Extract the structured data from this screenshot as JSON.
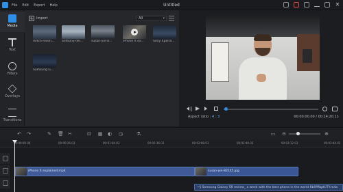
{
  "window": {
    "title": "Untitled",
    "menu": [
      "File",
      "Edit",
      "Export",
      "Help"
    ]
  },
  "sidebar": {
    "items": [
      {
        "label": "Media",
        "icon": "media-icon",
        "active": true
      },
      {
        "label": "Text",
        "icon": "text-icon"
      },
      {
        "label": "Filters",
        "icon": "filters-icon"
      },
      {
        "label": "Overlays",
        "icon": "overlays-icon"
      },
      {
        "label": "Transitions",
        "icon": "transitions-icon"
      }
    ]
  },
  "media": {
    "import_label": "Import",
    "filter_value": "All",
    "items": [
      {
        "label": "mitch-rosen..."
      },
      {
        "label": "anthony-del..."
      },
      {
        "label": "susan-yin-8..."
      },
      {
        "label": "iPhone X ex..."
      },
      {
        "label": "Sony Xperia..."
      },
      {
        "label": "Samsung G..."
      }
    ]
  },
  "preview": {
    "aspect_label": "Aspect ratio :",
    "aspect_value": "4 : 3",
    "timecode": "00:00:00.00 / 00:14:20.11"
  },
  "ruler": {
    "ticks": [
      "00:00:00.00",
      "00:00:26.03",
      "00:01:04.03",
      "00:01:36.03",
      "00:02:08.03",
      "00:02:40.03",
      "00:03:12.03",
      "00:03:44.03"
    ]
  },
  "timeline": {
    "video_clip": "iPhone X explained.mp4",
    "image_clip": "susan-yin-82145.jpg",
    "audio_clip": "~§ Samsung Galaxy S8 review_ a week with the best phone in the world-8b0ffNgdU7Y.m4a"
  },
  "colors": {
    "accent": "#2f8fe6",
    "clip_video": "#3f5a96",
    "background": "#1b1c1f"
  }
}
